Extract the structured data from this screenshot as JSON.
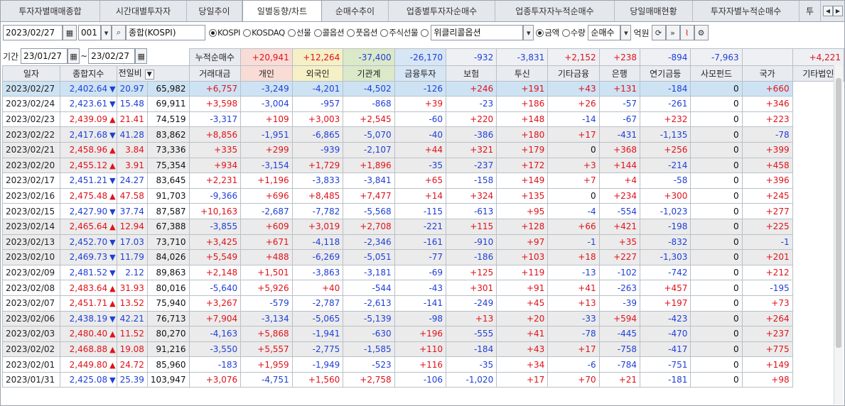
{
  "tabs": [
    "투자자별매매종합",
    "시간대별투자자",
    "당일추이",
    "일별동향/차트",
    "순매수추이",
    "업종별투자자순매수",
    "업종투자자누적순매수",
    "당일매매현황",
    "투자자별누적순매수",
    "투"
  ],
  "toolbar": {
    "date": "2023/02/27",
    "code": "001",
    "market": "종합(KOSPI)",
    "radios": [
      "KOSPI",
      "KOSDAQ",
      "선물",
      "콜옵션",
      "풋옵션",
      "주식선물"
    ],
    "weekly": "위클리콜옵션",
    "amount": "금액",
    "qty": "수량",
    "mode": "순매수",
    "unit": "억원"
  },
  "period": {
    "label": "기간",
    "from": "23/01/27",
    "sep": "~",
    "to": "23/02/27",
    "cum_label": "누적순매수"
  },
  "summary": [
    "+20,941",
    "+12,264",
    "-37,400",
    "-26,170",
    "-932",
    "-3,831",
    "+2,152",
    "+238",
    "-894",
    "-7,963",
    "",
    "+4,221"
  ],
  "headers": [
    "일자",
    "종합지수",
    "전일비",
    "거래대금",
    "개인",
    "외국인",
    "기관계",
    "금융투자",
    "보험",
    "투신",
    "기타금융",
    "은행",
    "연기금등",
    "사모펀드",
    "국가",
    "기타법인"
  ],
  "rows": [
    [
      "2023/02/27",
      "2,402.64",
      "down",
      "20.97",
      "65,982",
      "+6,757",
      "-3,249",
      "-4,201",
      "-4,502",
      "-126",
      "+246",
      "+191",
      "+43",
      "+131",
      "-184",
      "0",
      "+660"
    ],
    [
      "2023/02/24",
      "2,423.61",
      "down",
      "15.48",
      "69,911",
      "+3,598",
      "-3,004",
      "-957",
      "-868",
      "+39",
      "-23",
      "+186",
      "+26",
      "-57",
      "-261",
      "0",
      "+346"
    ],
    [
      "2023/02/23",
      "2,439.09",
      "up",
      "21.41",
      "74,519",
      "-3,317",
      "+109",
      "+3,003",
      "+2,545",
      "-60",
      "+220",
      "+148",
      "-14",
      "-67",
      "+232",
      "0",
      "+223"
    ],
    [
      "2023/02/22",
      "2,417.68",
      "down",
      "41.28",
      "83,862",
      "+8,856",
      "-1,951",
      "-6,865",
      "-5,070",
      "-40",
      "-386",
      "+180",
      "+17",
      "-431",
      "-1,135",
      "0",
      "-78"
    ],
    [
      "2023/02/21",
      "2,458.96",
      "up",
      "3.84",
      "73,336",
      "+335",
      "+299",
      "-939",
      "-2,107",
      "+44",
      "+321",
      "+179",
      "0",
      "+368",
      "+256",
      "0",
      "+399"
    ],
    [
      "2023/02/20",
      "2,455.12",
      "up",
      "3.91",
      "75,354",
      "+934",
      "-3,154",
      "+1,729",
      "+1,896",
      "-35",
      "-237",
      "+172",
      "+3",
      "+144",
      "-214",
      "0",
      "+458"
    ],
    [
      "2023/02/17",
      "2,451.21",
      "down",
      "24.27",
      "83,645",
      "+2,231",
      "+1,196",
      "-3,833",
      "-3,841",
      "+65",
      "-158",
      "+149",
      "+7",
      "+4",
      "-58",
      "0",
      "+396"
    ],
    [
      "2023/02/16",
      "2,475.48",
      "up",
      "47.58",
      "91,703",
      "-9,366",
      "+696",
      "+8,485",
      "+7,477",
      "+14",
      "+324",
      "+135",
      "0",
      "+234",
      "+300",
      "0",
      "+245"
    ],
    [
      "2023/02/15",
      "2,427.90",
      "down",
      "37.74",
      "87,587",
      "+10,163",
      "-2,687",
      "-7,782",
      "-5,568",
      "-115",
      "-613",
      "+95",
      "-4",
      "-554",
      "-1,023",
      "0",
      "+277"
    ],
    [
      "2023/02/14",
      "2,465.64",
      "up",
      "12.94",
      "67,388",
      "-3,855",
      "+609",
      "+3,019",
      "+2,708",
      "-221",
      "+115",
      "+128",
      "+66",
      "+421",
      "-198",
      "0",
      "+225"
    ],
    [
      "2023/02/13",
      "2,452.70",
      "down",
      "17.03",
      "73,710",
      "+3,425",
      "+671",
      "-4,118",
      "-2,346",
      "-161",
      "-910",
      "+97",
      "-1",
      "+35",
      "-832",
      "0",
      "-1"
    ],
    [
      "2023/02/10",
      "2,469.73",
      "down",
      "11.79",
      "84,026",
      "+5,549",
      "+488",
      "-6,269",
      "-5,051",
      "-77",
      "-186",
      "+103",
      "+18",
      "+227",
      "-1,303",
      "0",
      "+201"
    ],
    [
      "2023/02/09",
      "2,481.52",
      "down",
      "2.12",
      "89,863",
      "+2,148",
      "+1,501",
      "-3,863",
      "-3,181",
      "-69",
      "+125",
      "+119",
      "-13",
      "-102",
      "-742",
      "0",
      "+212"
    ],
    [
      "2023/02/08",
      "2,483.64",
      "up",
      "31.93",
      "80,016",
      "-5,640",
      "+5,926",
      "+40",
      "-544",
      "-43",
      "+301",
      "+91",
      "+41",
      "-263",
      "+457",
      "0",
      "-195"
    ],
    [
      "2023/02/07",
      "2,451.71",
      "up",
      "13.52",
      "75,940",
      "+3,267",
      "-579",
      "-2,787",
      "-2,613",
      "-141",
      "-249",
      "+45",
      "+13",
      "-39",
      "+197",
      "0",
      "+73"
    ],
    [
      "2023/02/06",
      "2,438.19",
      "down",
      "42.21",
      "76,713",
      "+7,904",
      "-3,134",
      "-5,065",
      "-5,139",
      "-98",
      "+13",
      "+20",
      "-33",
      "+594",
      "-423",
      "0",
      "+264"
    ],
    [
      "2023/02/03",
      "2,480.40",
      "up",
      "11.52",
      "80,270",
      "-4,163",
      "+5,868",
      "-1,941",
      "-630",
      "+196",
      "-555",
      "+41",
      "-78",
      "-445",
      "-470",
      "0",
      "+237"
    ],
    [
      "2023/02/02",
      "2,468.88",
      "up",
      "19.08",
      "91,216",
      "-3,550",
      "+5,557",
      "-2,775",
      "-1,585",
      "+110",
      "-184",
      "+43",
      "+17",
      "-758",
      "-417",
      "0",
      "+775"
    ],
    [
      "2023/02/01",
      "2,449.80",
      "up",
      "24.72",
      "85,960",
      "-183",
      "+1,959",
      "-1,949",
      "-523",
      "+116",
      "-35",
      "+34",
      "-6",
      "-784",
      "-751",
      "0",
      "+149"
    ],
    [
      "2023/01/31",
      "2,425.08",
      "down",
      "25.39",
      "103,947",
      "+3,076",
      "-4,751",
      "+1,560",
      "+2,758",
      "-106",
      "-1,020",
      "+17",
      "+70",
      "+21",
      "-181",
      "0",
      "+98"
    ]
  ],
  "colors": {
    "up": "#e0121b",
    "down": "#1f3fd8"
  }
}
